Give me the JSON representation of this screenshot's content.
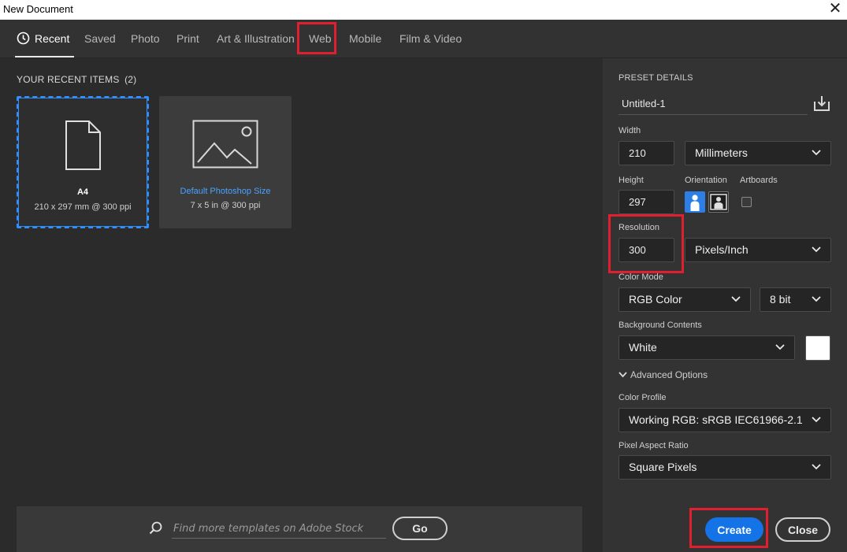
{
  "window": {
    "title": "New Document",
    "close_icon": "close-icon"
  },
  "tabs": [
    {
      "label": "Recent",
      "active": true,
      "icon": "clock-icon"
    },
    {
      "label": "Saved"
    },
    {
      "label": "Photo"
    },
    {
      "label": "Print"
    },
    {
      "label": "Art & Illustration"
    },
    {
      "label": "Web"
    },
    {
      "label": "Mobile"
    },
    {
      "label": "Film & Video"
    }
  ],
  "recent": {
    "title": "YOUR RECENT ITEMS",
    "count": "(2)",
    "items": [
      {
        "name": "A4",
        "meta": "210 x 297 mm @ 300 ppi",
        "icon": "document-icon",
        "selected": true
      },
      {
        "name": "Default Photoshop Size",
        "meta": "7 x 5 in @ 300 ppi",
        "icon": "image-icon",
        "selected": false
      }
    ]
  },
  "search": {
    "placeholder": "Find more templates on Adobe Stock",
    "go_label": "Go",
    "icon": "search-icon"
  },
  "preset": {
    "title": "PRESET DETAILS",
    "doc_name": "Untitled-1",
    "save_icon": "save-preset-icon",
    "width_label": "Width",
    "width_value": "210",
    "width_unit": "Millimeters",
    "height_label": "Height",
    "height_value": "297",
    "orientation_label": "Orientation",
    "artboards_label": "Artboards",
    "artboards_checked": false,
    "resolution_label": "Resolution",
    "resolution_value": "300",
    "resolution_unit": "Pixels/Inch",
    "color_mode_label": "Color Mode",
    "color_mode": "RGB Color",
    "bit_depth": "8 bit",
    "background_label": "Background Contents",
    "background": "White",
    "background_swatch": "#ffffff",
    "advanced_label": "Advanced Options",
    "color_profile_label": "Color Profile",
    "color_profile": "Working RGB: sRGB IEC61966-2.1",
    "pixel_aspect_label": "Pixel Aspect Ratio",
    "pixel_aspect": "Square Pixels"
  },
  "actions": {
    "create": "Create",
    "close": "Close"
  },
  "colors": {
    "accent": "#1473e6",
    "highlight": "#e0202e",
    "selection": "#2f8fff"
  }
}
